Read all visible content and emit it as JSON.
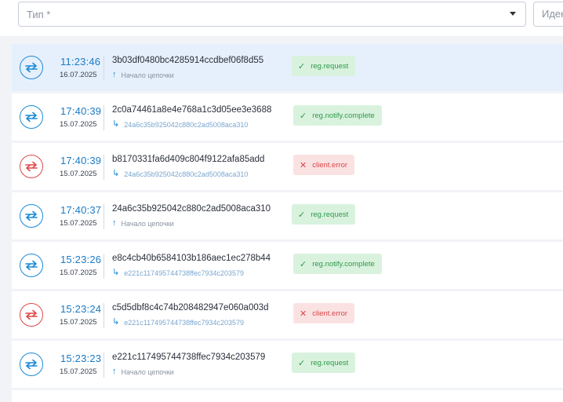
{
  "filters": {
    "type_placeholder": "Тип *",
    "id_placeholder": "Идентификатор"
  },
  "rows": [
    {
      "time": "11:23:46",
      "date": "16.07.2025",
      "hash": "3b03df0480bc4285914ccdbef06f8d55",
      "sub": "Начало цепочки",
      "sub_kind": "start",
      "badge": "reg.request",
      "status": "ok",
      "selected": true
    },
    {
      "time": "17:40:39",
      "date": "15.07.2025",
      "hash": "2c0a74461a8e4e768a1c3d05ee3e3688",
      "sub": "24a6c35b925042c880c2ad5008aca310",
      "sub_kind": "parent",
      "badge": "reg.notify.complete",
      "status": "ok",
      "selected": false
    },
    {
      "time": "17:40:39",
      "date": "15.07.2025",
      "hash": "b8170331fa6d409c804f9122afa85add",
      "sub": "24a6c35b925042c880c2ad5008aca310",
      "sub_kind": "parent",
      "badge": "client.error",
      "status": "error",
      "selected": false
    },
    {
      "time": "17:40:37",
      "date": "15.07.2025",
      "hash": "24a6c35b925042c880c2ad5008aca310",
      "sub": "Начало цепочки",
      "sub_kind": "start",
      "badge": "reg.request",
      "status": "ok",
      "selected": false
    },
    {
      "time": "15:23:26",
      "date": "15.07.2025",
      "hash": "e8c4cb40b6584103b186aec1ec278b44",
      "sub": "e221c117495744738ffec7934c203579",
      "sub_kind": "parent",
      "badge": "reg.notify.complete",
      "status": "ok",
      "selected": false
    },
    {
      "time": "15:23:24",
      "date": "15.07.2025",
      "hash": "c5d5dbf8c4c74b208482947e060a003d",
      "sub": "e221c117495744738ffec7934c203579",
      "sub_kind": "parent",
      "badge": "client.error",
      "status": "error",
      "selected": false
    },
    {
      "time": "15:23:23",
      "date": "15.07.2025",
      "hash": "e221c117495744738ffec7934c203579",
      "sub": "Начало цепочки",
      "sub_kind": "start",
      "badge": "reg.request",
      "status": "ok",
      "selected": false
    }
  ],
  "icons": {
    "row_icon": "exchange-arrows-icon",
    "start_icon": "arrow-up-icon",
    "parent_icon": "arrow-turn-right-icon",
    "ok_mark": "check-icon",
    "error_mark": "cross-icon"
  },
  "colors": {
    "accent": "#1a8ad6",
    "error": "#e04848",
    "ok_badge_bg": "#d9f2de",
    "error_badge_bg": "#fbe2e2",
    "selected_row_bg": "#e6f0fc"
  }
}
